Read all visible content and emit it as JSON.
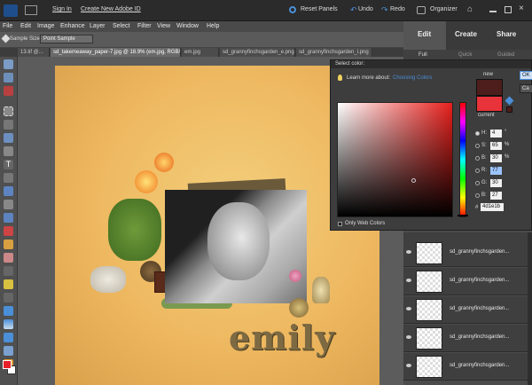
{
  "topbar": {
    "sign_in": "Sign In",
    "create_id": "Create New Adobe ID",
    "reset_panels": "Reset Panels",
    "undo": "Undo",
    "redo": "Redo",
    "organizer": "Organizer"
  },
  "menu": [
    "File",
    "Edit",
    "Image",
    "Enhance",
    "Layer",
    "Select",
    "Filter",
    "View",
    "Window",
    "Help"
  ],
  "options": {
    "sample_size_label": "Sample Size:",
    "sample_size_value": "Point Sample"
  },
  "doc_tabs": [
    "13.tif @...",
    "sd_takemeaway_paper-7.jpg @ 18.9% (em.jpg, RGB/8) *",
    "em.jpg",
    "sd_grannyfinchsgarden_e.png",
    "sd_grannyfinchsgarden_i.png"
  ],
  "panel": {
    "tabs": [
      "Edit",
      "Create",
      "Share"
    ],
    "subtabs": [
      "Full",
      "Quick",
      "Guided"
    ],
    "layers": [
      "sd_grannyfinchsgarden...",
      "sd_grannyfinchsgarden...",
      "sd_grannyfinchsgarden...",
      "sd_grannyfinchsgarden...",
      "sd_grannyfinchsgarden..."
    ]
  },
  "color_picker": {
    "title": "Select color:",
    "learn_prefix": "Learn more about:",
    "learn_link": "Choosing Colors",
    "new_label": "new",
    "current_label": "current",
    "new_color": "#4d1e1b",
    "current_color": "#e8333a",
    "hue_deg": 4,
    "fields": [
      {
        "label": "H:",
        "value": "4",
        "unit": "°"
      },
      {
        "label": "S:",
        "value": "65",
        "unit": "%"
      },
      {
        "label": "B:",
        "value": "30",
        "unit": "%"
      },
      {
        "label": "R:",
        "value": "77",
        "unit": ""
      },
      {
        "label": "G:",
        "value": "30",
        "unit": ""
      },
      {
        "label": "B:",
        "value": "27",
        "unit": ""
      }
    ],
    "hex_label": "#",
    "hex_value": "4d1e1b",
    "only_web_colors": "Only Web Colors",
    "ok_label": "OK",
    "cancel_label": "Ca"
  },
  "canvas": {
    "word_art": "emily"
  },
  "colors": {
    "foreground": "#e8202a",
    "background": "#ffffff",
    "accent_blue": "#4a8fd8"
  }
}
